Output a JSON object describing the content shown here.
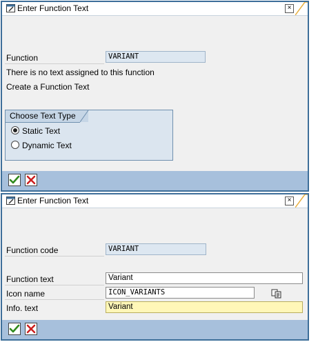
{
  "dialog1": {
    "title": "Enter Function Text",
    "function_label": "Function",
    "function_value": "VARIANT",
    "message_line1": "There is no text assigned to this function",
    "message_line2": "Create a Function Text",
    "group_title": "Choose Text Type",
    "radio_static": "Static Text",
    "radio_dynamic": "Dynamic Text",
    "selected": "Static Text"
  },
  "dialog2": {
    "title": "Enter Function Text",
    "function_code_label": "Function code",
    "function_code_value": "VARIANT",
    "function_text_label": "Function text",
    "function_text_value": "Variant",
    "icon_name_label": "Icon name",
    "icon_name_value": "ICON_VARIANTS",
    "info_text_label": "Info. text",
    "info_text_value": "Variant"
  },
  "colors": {
    "frame": "#3d6e99",
    "footer": "#a7c0dc",
    "required_field": "#fff7b8",
    "readonly_field": "#dde7f1"
  },
  "icons": [
    "window-edit-icon",
    "close-icon",
    "confirm-check-icon",
    "cancel-x-icon",
    "search-help-icon"
  ]
}
